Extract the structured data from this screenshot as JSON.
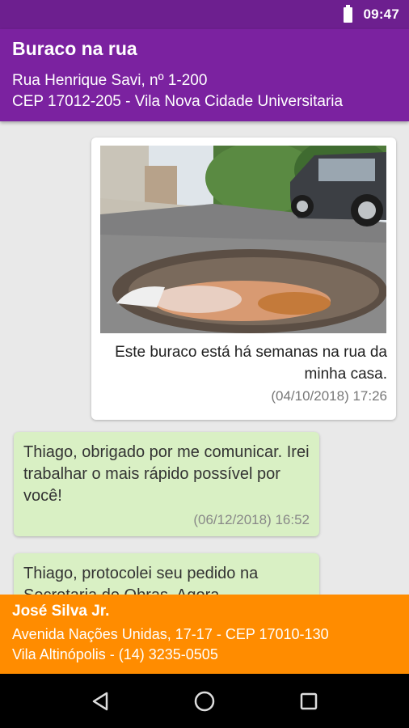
{
  "status_bar": {
    "time": "09:47",
    "battery_icon": "battery-full-icon"
  },
  "app_bar": {
    "title": "Buraco na rua",
    "address_line1": "Rua Henrique Savi, nº 1-200",
    "address_line2": "CEP 17012-205 - Vila Nova Cidade Universitaria",
    "color": "#7b22a0"
  },
  "messages": [
    {
      "type": "outgoing",
      "has_photo": true,
      "text": "Este buraco está há semanas na rua da minha casa.",
      "timestamp": "(04/10/2018) 17:26"
    },
    {
      "type": "incoming",
      "text": "Thiago, obrigado por me comunicar. Irei trabalhar o mais rápido possível por você!",
      "timestamp": "(06/12/2018) 16:52"
    },
    {
      "type": "incoming",
      "text": "Thiago, protocolei seu pedido na Secretaria de Obras. Agora",
      "timestamp": ""
    }
  ],
  "contact": {
    "name": "José Silva Jr.",
    "address_line1": "Avenida Nações Unidas, 17-17 - CEP 17010-130",
    "address_line2": "Vila Altinópolis - (14) 3235-0505",
    "color": "#ff8c00"
  },
  "nav_bar": {
    "back_icon": "back-triangle-icon",
    "home_icon": "home-circle-icon",
    "recents_icon": "recents-square-icon"
  }
}
